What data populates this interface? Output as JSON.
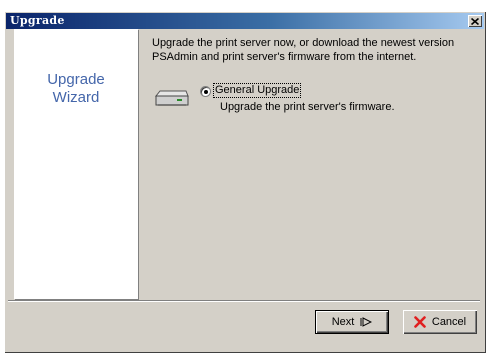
{
  "window": {
    "title": "Upgrade",
    "close_icon": "close-x-icon"
  },
  "wizard_panel": {
    "title_line1": "Upgrade",
    "title_line2": "Wizard"
  },
  "intro": {
    "line1": "Upgrade the print server now, or download the newest version",
    "line2": "PSAdmin and print server's firmware from the internet."
  },
  "option": {
    "icon": "printer-device-icon",
    "label": "General Upgrade",
    "selected": true,
    "description": "Upgrade the print server's firmware."
  },
  "buttons": {
    "next_label": "Next",
    "next_icon": "next-arrow-icon",
    "cancel_label": "Cancel",
    "cancel_icon": "red-x-icon"
  },
  "colors": {
    "accent": "#4466aa",
    "cancel_icon": "#e02020"
  }
}
